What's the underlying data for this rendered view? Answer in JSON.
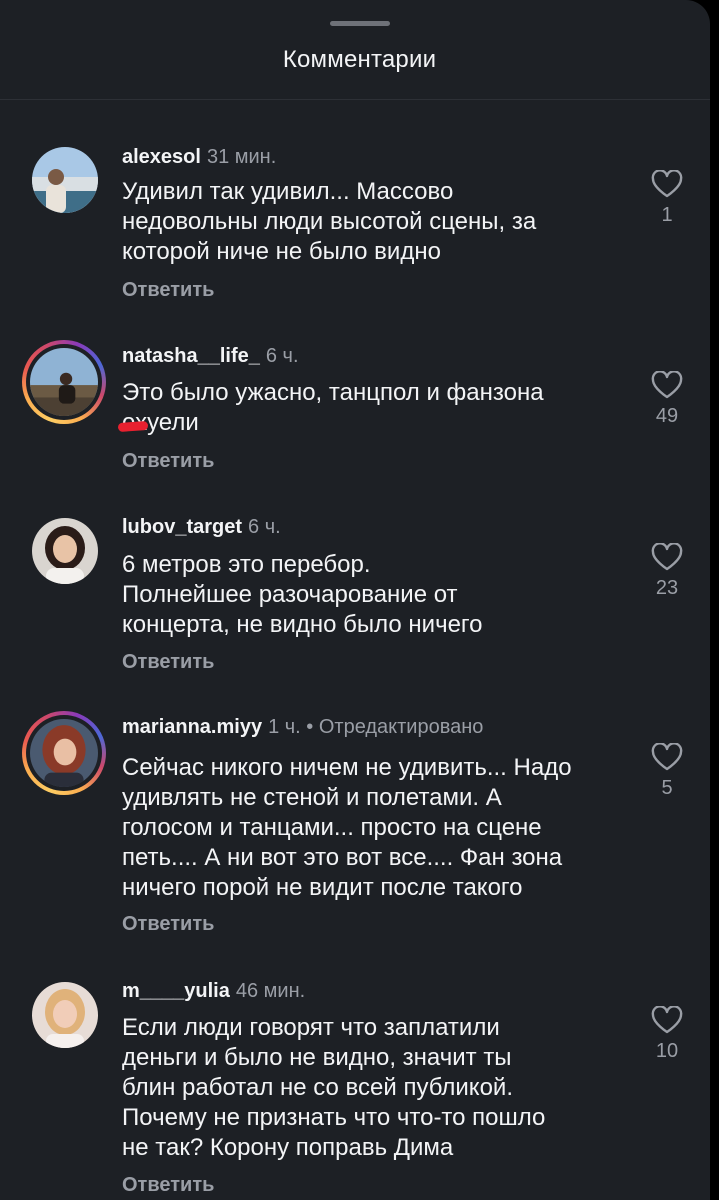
{
  "header": {
    "title": "Комментарии"
  },
  "comments": [
    {
      "username": "alexesol",
      "time": "31 мин.",
      "edited": "",
      "lines": [
        "Удивил так удивил... Массово",
        "недовольны люди высотой сцены, за",
        "которой ниче не было видно"
      ],
      "reply_label": "Ответить",
      "likes": "1",
      "avatar": "photo-man-on-beach",
      "story_ring": false
    },
    {
      "username": "natasha__life_",
      "time": "6 ч.",
      "edited": "",
      "lines": [
        "Это было ужасно, танцпол и фанзона",
        "охуели"
      ],
      "reply_label": "Ответить",
      "likes": "49",
      "avatar": "photo-woman-sitting",
      "story_ring": true
    },
    {
      "username": "lubov_target",
      "time": "6 ч.",
      "edited": "",
      "lines": [
        "6 метров это перебор.",
        "Полнейшее разочарование от",
        "концерта, не видно было ничего"
      ],
      "reply_label": "Ответить",
      "likes": "23",
      "avatar": "photo-woman-dark-hair",
      "story_ring": false
    },
    {
      "username": "marianna.miyy",
      "time": "1 ч.",
      "edited": "• Отредактировано",
      "lines": [
        "Сейчас никого ничем не удивить... Надо",
        "удивлять не стеной и полетами. А",
        "голосом и танцами... просто на сцене",
        "петь.... А ни вот это вот все.... Фан зона",
        "ничего порой не видит после такого"
      ],
      "reply_label": "Ответить",
      "likes": "5",
      "avatar": "photo-woman-auburn-hair",
      "story_ring": true
    },
    {
      "username": "m____yulia",
      "time": "46 мин.",
      "edited": "",
      "lines": [
        "Если люди говорят что заплатили",
        "деньги и было не видно, значит ты",
        "блин работал не со всей публикой.",
        "Почему не признать что что-то пошло",
        "не так? Корону поправь Дима"
      ],
      "reply_label": "Ответить",
      "likes": "10",
      "avatar": "photo-woman-blonde",
      "story_ring": false
    }
  ],
  "icons": {
    "like": "heart-outline-icon",
    "drag_handle": "drag-handle"
  },
  "colors": {
    "sheet_background": "#1d2025",
    "primary_text": "#f3f4f6",
    "secondary_text": "#9a9ea6",
    "censor_mark": "#e8202f"
  }
}
